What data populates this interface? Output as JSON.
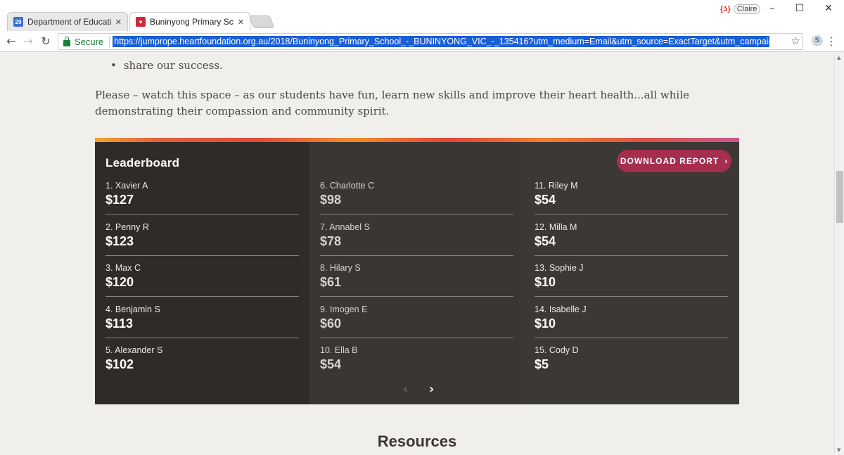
{
  "browser": {
    "tabs": [
      {
        "label": "Department of Educatio",
        "favicon_text": "29",
        "favicon_color": "#3b6fd6"
      },
      {
        "label": "Buninyong Primary Scho",
        "favicon_text": "♥",
        "favicon_color": "#d0283a"
      }
    ],
    "profile_name": "Claire",
    "secure_label": "Secure",
    "url": "https://jumprope.heartfoundation.org.au/2018/Buninyong_Primary_School_-_BUNINYONG_VIC_-_135416?utm_medium=Email&utm_source=ExactTarget&utm_campaign="
  },
  "content": {
    "bullet": "share our success.",
    "paragraph": "Please – watch this space – as our students have fun, learn new skills and improve their heart health...all while demonstrating their compassion and community spirit.",
    "resources_heading": "Resources"
  },
  "leaderboard": {
    "title": "Leaderboard",
    "download_label": "DOWNLOAD REPORT",
    "columns": [
      [
        {
          "name": "1. Xavier A",
          "amount": "$127"
        },
        {
          "name": "2. Penny R",
          "amount": "$123"
        },
        {
          "name": "3. Max C",
          "amount": "$120"
        },
        {
          "name": "4. Benjamin S",
          "amount": "$113"
        },
        {
          "name": "5. Alexander S",
          "amount": "$102"
        }
      ],
      [
        {
          "name": "6. Charlotte C",
          "amount": "$98"
        },
        {
          "name": "7. Annabel S",
          "amount": "$78"
        },
        {
          "name": "8. Hilary S",
          "amount": "$61"
        },
        {
          "name": "9. Imogen E",
          "amount": "$60"
        },
        {
          "name": "10. Ella B",
          "amount": "$54"
        }
      ],
      [
        {
          "name": "11. Riley M",
          "amount": "$54"
        },
        {
          "name": "12. Milla M",
          "amount": "$54"
        },
        {
          "name": "13. Sophie J",
          "amount": "$10"
        },
        {
          "name": "14. Isabelle J",
          "amount": "$10"
        },
        {
          "name": "15. Cody D",
          "amount": "$5"
        }
      ]
    ]
  },
  "colors": {
    "accent_button": "#a52d4d",
    "panel_dark": "#2f2b29"
  }
}
